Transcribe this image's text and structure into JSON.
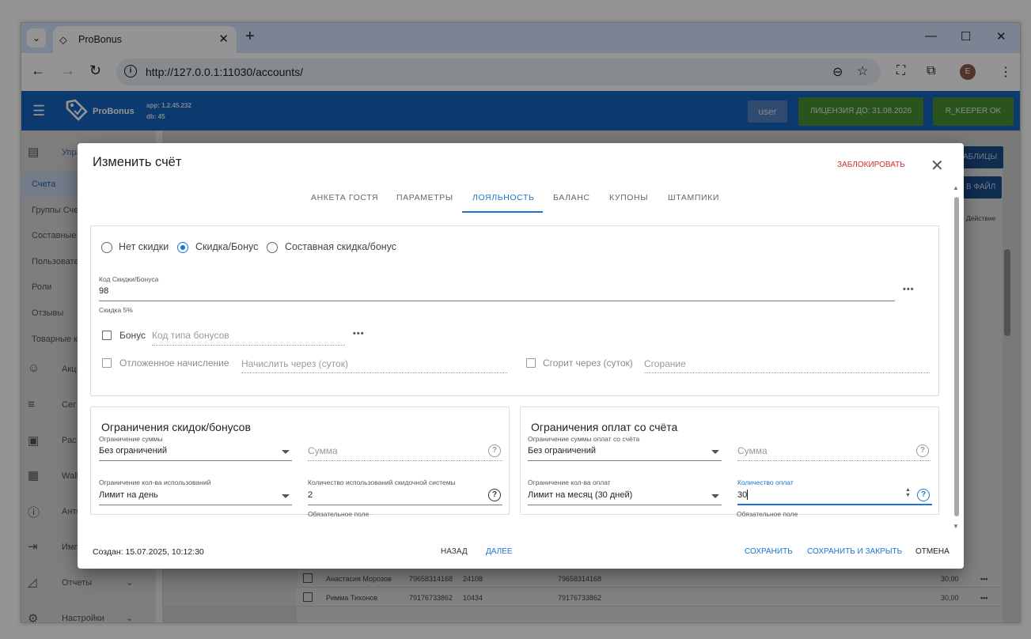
{
  "browser": {
    "tab_title": "ProBonus",
    "url": "http://127.0.0.1:11030/accounts/",
    "profile_initial": "E"
  },
  "app": {
    "name": "ProBonus",
    "version": "app: 1.2.45.232",
    "db": "db: 45",
    "user_label": "user",
    "license_label": "ЛИЦЕНЗИЯ ДО: 31.08.2026",
    "rkeeper_label": "R_KEEPER OK",
    "brand_color": "#1565c0",
    "status_color": "#4a8f35"
  },
  "sidebar": {
    "group_label": "Упра",
    "items": [
      {
        "label": "Счета"
      },
      {
        "label": "Группы Сче"
      },
      {
        "label": "Составные"
      },
      {
        "label": "Пользовате"
      },
      {
        "label": "Роли"
      },
      {
        "label": "Отзывы"
      },
      {
        "label": "Товарные к"
      }
    ],
    "sections": [
      {
        "label": "Акц",
        "icon": "smile-icon"
      },
      {
        "label": "Сег",
        "icon": "filter-lines-icon"
      },
      {
        "label": "Рас",
        "icon": "mail-icon"
      },
      {
        "label": "Wall",
        "icon": "wallet-icon"
      },
      {
        "label": "Анти",
        "icon": "alert-icon"
      },
      {
        "label": "Имп",
        "icon": "import-icon"
      },
      {
        "label": "Отчеты",
        "icon": "chart-icon"
      },
      {
        "label": "Настройки",
        "icon": "gear-icon"
      }
    ]
  },
  "background": {
    "tables_btn": "АБЛИЦЫ",
    "file_btn": "В ФАЙЛ",
    "action_col": "Действие",
    "rows": [
      {
        "name": "Анастасия Морозов",
        "phone": "79658314168",
        "code": "24108",
        "login": "79658314168",
        "value": "30,00"
      },
      {
        "name": "Римма Тихонов",
        "phone": "79176733862",
        "code": "10434",
        "login": "79176733862",
        "value": "30,00"
      }
    ]
  },
  "dialog": {
    "title": "Изменить счёт",
    "block_label": "ЗАБЛОКИРОВАТЬ",
    "tabs": [
      "АНКЕТА ГОСТЯ",
      "ПАРАМЕТРЫ",
      "ЛОЯЛЬНОСТЬ",
      "БАЛАНС",
      "КУПОНЫ",
      "ШТАМПИКИ"
    ],
    "discount_type": {
      "options": [
        "Нет скидки",
        "Скидка/Бонус",
        "Составная скидка/бонус"
      ],
      "selected": "Скидка/Бонус"
    },
    "discount_code": {
      "label": "Код Скидки/Бонуса",
      "value": "98",
      "hint": "Скидка 5%"
    },
    "bonus": {
      "label": "Бонус",
      "type_placeholder": "Код типа бонусов"
    },
    "deferred": {
      "label": "Отложенное начисление",
      "placeholder": "Начислить через (суток)"
    },
    "expire": {
      "label": "Сгорит через (суток)",
      "placeholder": "Сгорание"
    },
    "discount_limits": {
      "title": "Ограничения скидок/бонусов",
      "sum_label": "Ограничение суммы",
      "sum_value": "Без ограничений",
      "sum_placeholder": "Сумма",
      "count_label": "Ограничение кол-ва использований",
      "count_value": "Лимит на день",
      "uses_label": "Количество использований скидочной системы",
      "uses_value": "2",
      "required_hint": "Обязательное поле"
    },
    "payment_limits": {
      "title": "Ограничения оплат со счёта",
      "sum_label": "Ограничение суммы оплат со счёта",
      "sum_value": "Без ограничений",
      "sum_placeholder": "Сумма",
      "count_label": "Ограничение кол-ва оплат",
      "count_value": "Лимит на месяц (30 дней)",
      "payments_label": "Количество оплат",
      "payments_value": "30",
      "required_hint": "Обязательное поле"
    },
    "footer": {
      "created": "Создан: 15.07.2025, 10:12:30",
      "back": "НАЗАД",
      "next": "ДАЛЕЕ",
      "save": "СОХРАНИТЬ",
      "save_close": "СОХРАНИТЬ И ЗАКРЫТЬ",
      "cancel": "ОТМЕНА"
    },
    "accent_color": "#1976d2",
    "danger_color": "#d32f2f"
  }
}
